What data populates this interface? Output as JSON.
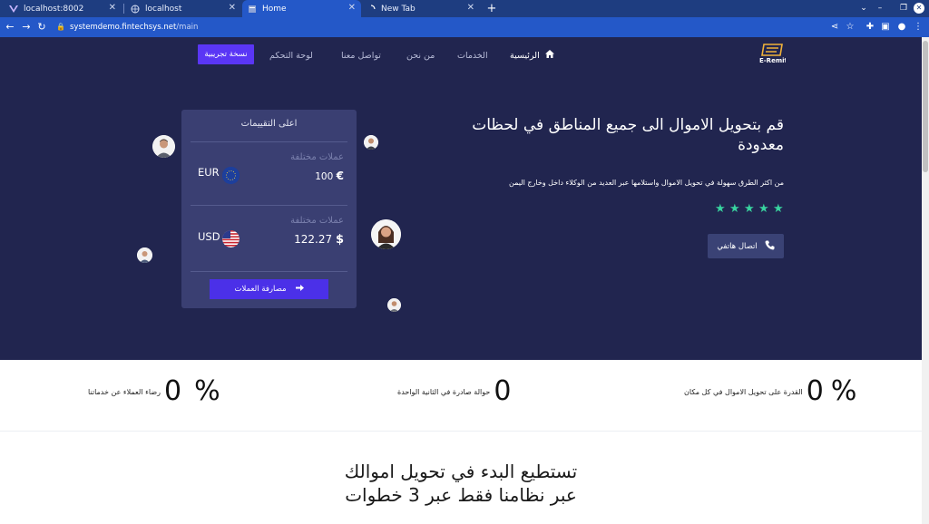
{
  "browser": {
    "tabs": [
      {
        "title": "localhost:8002",
        "favicon": "vue-logo-icon",
        "active": false
      },
      {
        "title": "localhost",
        "favicon": "globe-icon",
        "active": false
      },
      {
        "title": "Home",
        "favicon": "page-icon",
        "active": true
      },
      {
        "title": "New Tab",
        "favicon": "loading-icon",
        "active": false
      }
    ],
    "url_host": "systemdemo.fintechsys.net",
    "url_path": "/main",
    "colors": {
      "tabstrip": "#1e3d80",
      "toolbar": "#2458c8"
    }
  },
  "site": {
    "nav": {
      "home": "الرئيسية",
      "services": "الخدمات",
      "about": "من نحن",
      "contact": "تواصل معنا",
      "dashboard": "لوحة التحكم",
      "demo": "نسخة تجريبية"
    },
    "logo_text": "E-Remit",
    "hero": {
      "title": "قم بتحويل الاموال الى جميع المناطق في لحظات معدودة",
      "subtitle": "من اكثر الطرق سهولة في تحويل الاموال واستلامها عبر العديد من الوكلاء داخل وخارج اليمن",
      "rating": 5,
      "call_button": "اتصال هاتفي"
    },
    "card": {
      "title": "اعلى التقييمات",
      "rows": [
        {
          "label": "عملات مختلفة",
          "code": "EUR",
          "amount": "100",
          "symbol": "€",
          "flag": "eu-flag-icon"
        },
        {
          "label": "عملات مختلفة",
          "code": "USD",
          "amount": "122.27",
          "symbol": "$",
          "flag": "us-flag-icon"
        }
      ],
      "button": "مصارفة العملات"
    },
    "stats": [
      {
        "value": "0",
        "suffix": "%",
        "label": "القدرة على تحويل الاموال في كل مكان"
      },
      {
        "value": "0",
        "suffix": "",
        "label": "حوالة صادرة في الثانية الواحدة"
      },
      {
        "value": "0",
        "suffix": "%",
        "label": "رضاء العملاء عن خدماتنا"
      }
    ],
    "steps_title_line1": "تستطيع البدء في تحويل اموالك",
    "steps_title_line2": "عبر نظامنا فقط عبر 3 خطوات",
    "colors": {
      "hero_bg": "#21254f",
      "card_bg": "#3a3f72",
      "accent": "#5a36f5",
      "star": "#38d39f"
    }
  }
}
